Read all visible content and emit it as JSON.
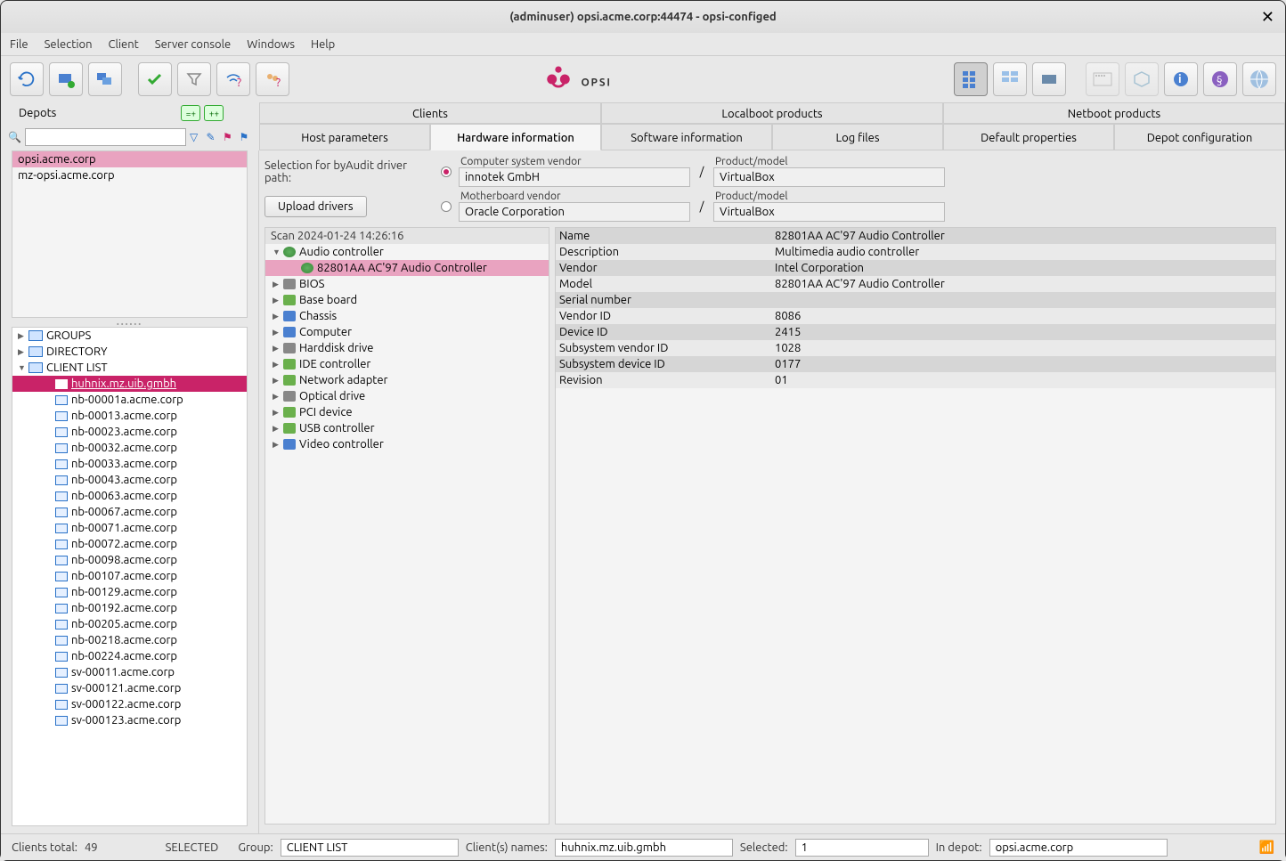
{
  "window": {
    "title": "(adminuser) opsi.acme.corp:44474 - opsi-configed",
    "close": "✕"
  },
  "menu": {
    "file": "File",
    "selection": "Selection",
    "client": "Client",
    "server_console": "Server console",
    "windows": "Windows",
    "help": "Help"
  },
  "tabs1": {
    "depots_label": "Depots",
    "clients": "Clients",
    "localboot": "Localboot products",
    "netboot": "Netboot products",
    "dep_btn1": "=+",
    "dep_btn2": "++"
  },
  "tabs2": {
    "host_params": "Host parameters",
    "hardware_info": "Hardware information",
    "software_info": "Software information",
    "log_files": "Log files",
    "default_props": "Default properties",
    "depot_config": "Depot configuration"
  },
  "depots": {
    "items": [
      {
        "name": "opsi.acme.corp",
        "selected": true
      },
      {
        "name": "mz-opsi.acme.corp",
        "selected": false
      }
    ]
  },
  "client_tree": {
    "groups_label": "GROUPS",
    "directory_label": "DIRECTORY",
    "client_list_label": "CLIENT LIST",
    "selected": "huhnix.mz.uib.gmbh",
    "clients": [
      "huhnix.mz.uib.gmbh",
      "nb-00001a.acme.corp",
      "nb-00013.acme.corp",
      "nb-00023.acme.corp",
      "nb-00032.acme.corp",
      "nb-00033.acme.corp",
      "nb-00043.acme.corp",
      "nb-00063.acme.corp",
      "nb-00067.acme.corp",
      "nb-00071.acme.corp",
      "nb-00072.acme.corp",
      "nb-00098.acme.corp",
      "nb-00107.acme.corp",
      "nb-00129.acme.corp",
      "nb-00192.acme.corp",
      "nb-00205.acme.corp",
      "nb-00218.acme.corp",
      "nb-00224.acme.corp",
      "sv-00011.acme.corp",
      "sv-000121.acme.corp",
      "sv-000122.acme.corp",
      "sv-000123.acme.corp"
    ]
  },
  "driver": {
    "selection_label": "Selection for byAudit driver path:",
    "upload_label": "Upload drivers",
    "cs_vendor_label": "Computer system vendor",
    "cs_vendor": "innotek GmbH",
    "pm_label": "Product/model",
    "pm1": "VirtualBox",
    "mb_vendor_label": "Motherboard vendor",
    "mb_vendor": "Oracle Corporation",
    "pm2": "VirtualBox",
    "slash": "/"
  },
  "hw_tree": {
    "scan": "Scan 2024-01-24 14:26:16",
    "audio_controller": "Audio controller",
    "audio_item": "82801AA AC'97 Audio Controller",
    "bios": "BIOS",
    "baseboard": "Base board",
    "chassis": "Chassis",
    "computer": "Computer",
    "harddisk": "Harddisk drive",
    "ide": "IDE controller",
    "netadapter": "Network adapter",
    "optical": "Optical drive",
    "pci": "PCI device",
    "usb": "USB controller",
    "video": "Video controller"
  },
  "hw_detail": {
    "rows": [
      {
        "k": "Name",
        "v": "82801AA AC'97 Audio Controller"
      },
      {
        "k": "Description",
        "v": "Multimedia audio controller"
      },
      {
        "k": "Vendor",
        "v": "Intel Corporation"
      },
      {
        "k": "Model",
        "v": "82801AA AC'97 Audio Controller"
      },
      {
        "k": "Serial number",
        "v": ""
      },
      {
        "k": "Vendor ID",
        "v": "8086"
      },
      {
        "k": "Device ID",
        "v": "2415"
      },
      {
        "k": "Subsystem vendor ID",
        "v": "1028"
      },
      {
        "k": "Subsystem device ID",
        "v": "0177"
      },
      {
        "k": "Revision",
        "v": "01"
      }
    ]
  },
  "status": {
    "clients_total_label": "Clients total:",
    "clients_total": "49",
    "selected_label": "SELECTED",
    "group_label": "Group:",
    "group": "CLIENT LIST",
    "client_names_label": "Client(s) names:",
    "client_names": "huhnix.mz.uib.gmbh",
    "selected_count_label": "Selected:",
    "selected_count": "1",
    "in_depot_label": "In depot:",
    "in_depot": "opsi.acme.corp"
  },
  "logo_text": "OPSI"
}
